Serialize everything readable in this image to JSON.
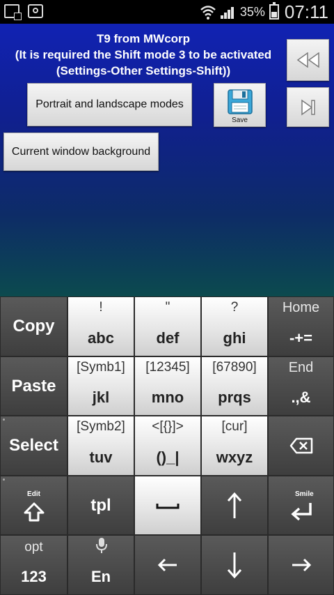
{
  "status": {
    "battery": "35%",
    "time": "07:11",
    "icons": [
      "notification-x-icon",
      "screenshot-icon",
      "wifi-icon",
      "signal-icon",
      "battery-icon"
    ]
  },
  "settings": {
    "title_line1": "T9 from MWcorp",
    "title_line2": "(It is required the Shift mode 3 to be activated",
    "title_line3": "(Settings-Other Settings-Shift))",
    "portrait_btn": "Portrait and landscape modes",
    "background_btn": "Current window background",
    "save_label": "Save",
    "icons": [
      "rewind-icon",
      "skip-next-icon",
      "floppy-save-icon"
    ]
  },
  "keyboard": {
    "copy": "Copy",
    "paste": "Paste",
    "select": "Select",
    "home": "Home",
    "home_sub": "-+=",
    "end": "End",
    "end_sub": ".,&",
    "k1_top": "!",
    "k1_main": "abc",
    "k2_top": "\"",
    "k2_main": "def",
    "k3_top": "?",
    "k3_main": "ghi",
    "k4_top": "[Symb1]",
    "k4_main": "jkl",
    "k5_top": "[12345]",
    "k5_main": "mno",
    "k6_top": "[67890]",
    "k6_main": "prqs",
    "k7_top": "[Symb2]",
    "k7_main": "tuv",
    "k8_top": "<[{}]>",
    "k8_main": "()_|",
    "k9_top": "[cur]",
    "k9_main": "wxyz",
    "edit_tag": "Edit",
    "tpl": "tpl",
    "smile_tag": "Smile",
    "opt": "opt",
    "num": "123",
    "lang": "En",
    "icons": [
      "shift-arrow-icon",
      "space-icon",
      "arrow-up-icon",
      "enter-icon",
      "backspace-icon",
      "microphone-icon",
      "arrow-left-icon",
      "arrow-down-icon",
      "arrow-right-icon"
    ]
  }
}
